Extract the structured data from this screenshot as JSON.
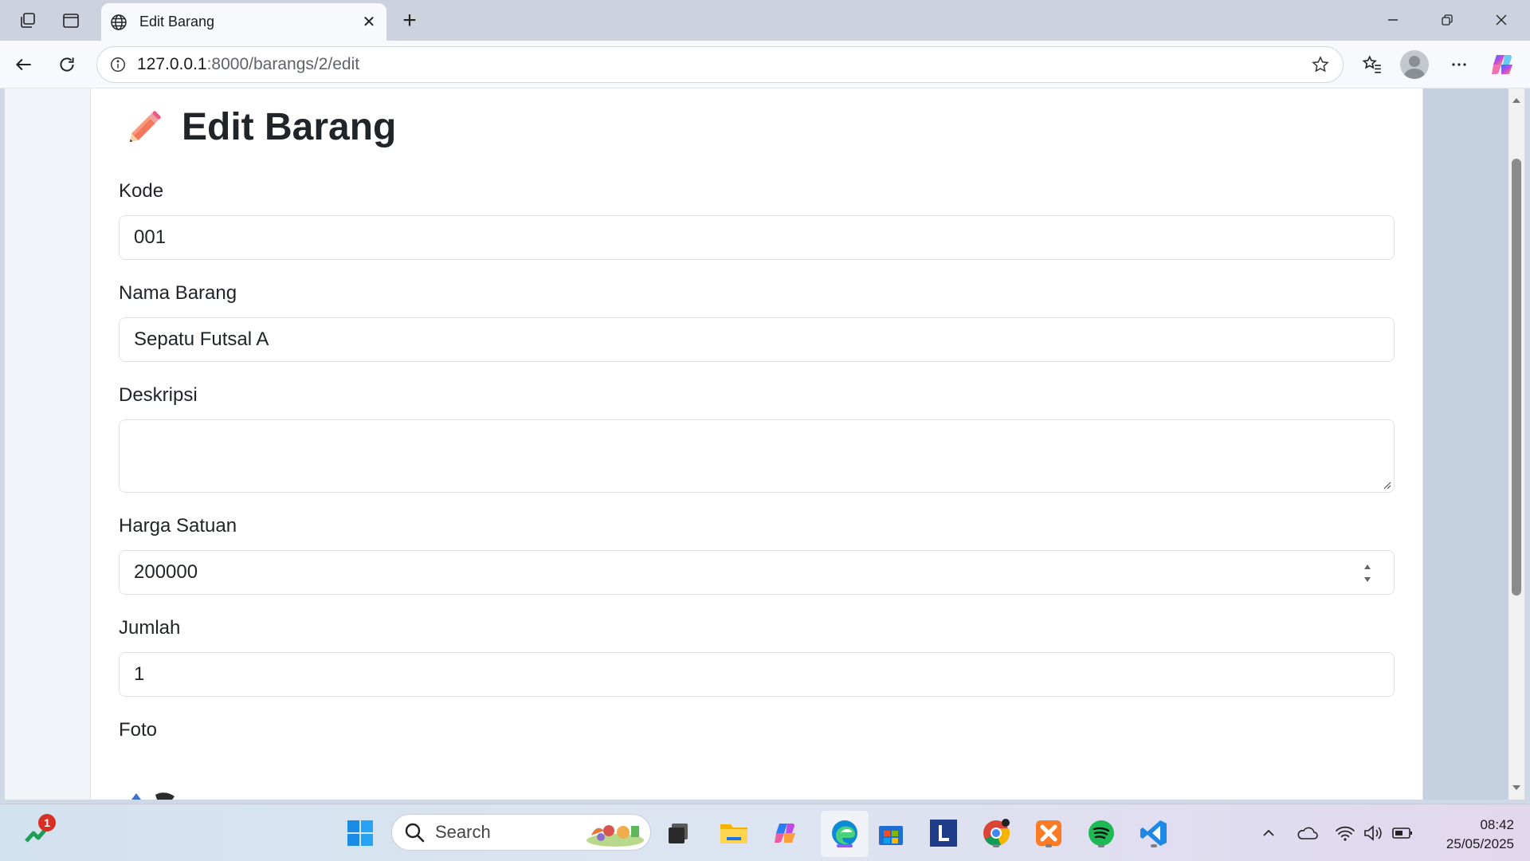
{
  "browser": {
    "tab_title": "Edit Barang",
    "url_host": "127.0.0.1",
    "url_path": ":8000/barangs/2/edit"
  },
  "page": {
    "heading": "Edit Barang",
    "heading_icon": "pencil-icon",
    "fields": {
      "kode": {
        "label": "Kode",
        "value": "001"
      },
      "nama": {
        "label": "Nama Barang",
        "value": "Sepatu Futsal A"
      },
      "deskripsi": {
        "label": "Deskripsi",
        "value": ""
      },
      "harga": {
        "label": "Harga Satuan",
        "value": "200000"
      },
      "jumlah": {
        "label": "Jumlah",
        "value": "1"
      },
      "foto": {
        "label": "Foto"
      }
    }
  },
  "taskbar": {
    "search_label": "Search",
    "notification_count": "1",
    "time": "08:42",
    "date": "25/05/2025"
  },
  "colors": {
    "accent_edge": "#0078d4",
    "pencil": "#f4775b"
  }
}
